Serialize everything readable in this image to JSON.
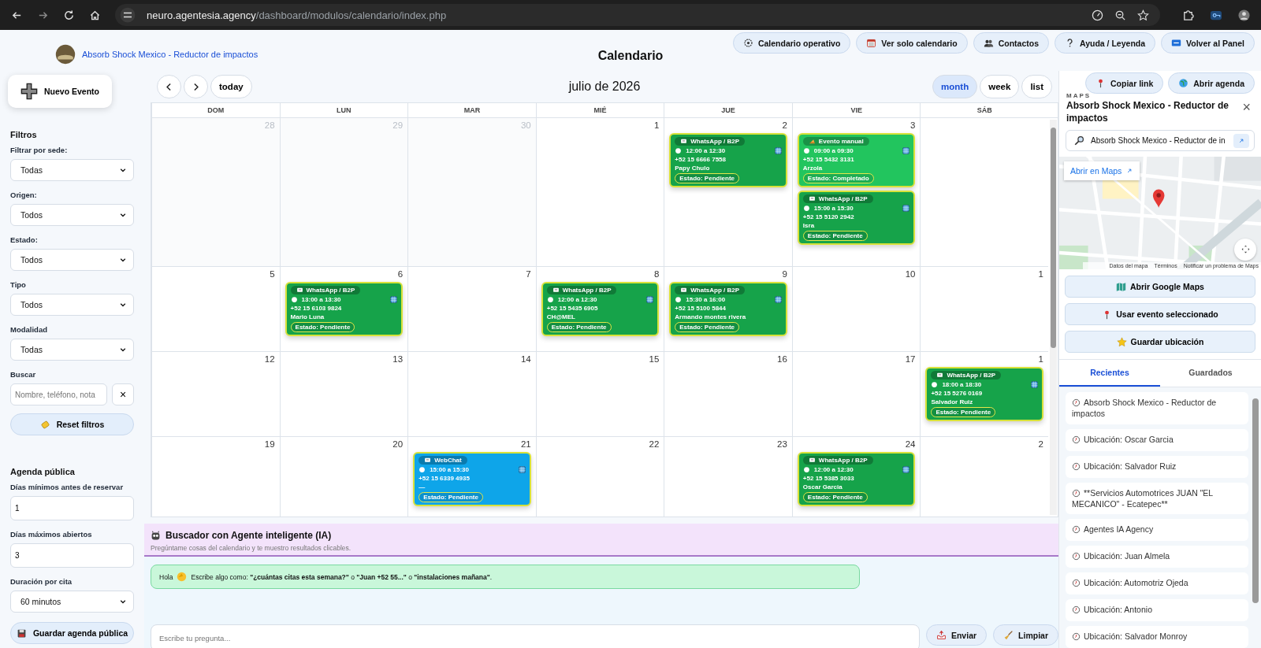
{
  "browser": {
    "host": "neuro.agentesia.agency",
    "path": "/dashboard/modulos/calendario/index.php"
  },
  "header": {
    "brand": "Absorb Shock Mexico - Reductor de impactos",
    "title": "Calendario",
    "actions": [
      "Calendario operativo",
      "Ver solo calendario",
      "Contactos",
      "Ayuda / Leyenda",
      "Volver al Panel"
    ]
  },
  "sidebar": {
    "new_event": "Nuevo Evento",
    "filters_title": "Filtros",
    "filters": [
      {
        "label": "Filtrar por sede:",
        "value": "Todas"
      },
      {
        "label": "Origen:",
        "value": "Todos"
      },
      {
        "label": "Estado:",
        "value": "Todos"
      },
      {
        "label": "Tipo",
        "value": "Todos"
      },
      {
        "label": "Modalidad",
        "value": "Todas"
      }
    ],
    "search": {
      "label": "Buscar",
      "placeholder": "Nombre, teléfono, nota",
      "clear": "×"
    },
    "reset": "Reset filtros",
    "public_title": "Agenda pública",
    "public_fields": [
      {
        "label": "Días mínimos antes de reservar",
        "value": "1",
        "kind": "input"
      },
      {
        "label": "Días máximos abiertos",
        "value": "3",
        "kind": "input"
      },
      {
        "label": "Duración por cita",
        "value": "60 minutos",
        "kind": "select"
      }
    ],
    "save": "Guardar agenda pública"
  },
  "calendar": {
    "today": "today",
    "title": "julio de 2026",
    "views": [
      {
        "label": "month",
        "selected": true
      },
      {
        "label": "week",
        "selected": false
      },
      {
        "label": "list",
        "selected": false
      }
    ],
    "weekdays": [
      "DOM",
      "LUN",
      "MAR",
      "MIÉ",
      "JUE",
      "VIE",
      "SÁB"
    ],
    "weeks": [
      {
        "days": [
          {
            "number": "28",
            "other_month": true
          },
          {
            "number": "29",
            "other_month": true
          },
          {
            "number": "30",
            "other_month": true
          },
          {
            "number": "1",
            "other_month": false
          },
          {
            "number": "2",
            "other_month": false,
            "events": [
              {
                "channel": "WhatsApp / B2P",
                "kind": "chat",
                "time": "12:00 a 12:30",
                "phone": "+52 15 6666 7558",
                "name": "Papy Chulo",
                "status": "Estado: Pendiente",
                "color": "#16a34a"
              }
            ]
          },
          {
            "number": "3",
            "other_month": false,
            "events": [
              {
                "channel": "Evento manual",
                "kind": "manual",
                "time": "09:00 a 09:30",
                "phone": "+52 15 5432 3131",
                "name": "Arzola",
                "status": "Estado: Completado",
                "color": "#22c55e"
              },
              {
                "channel": "WhatsApp / B2P",
                "kind": "chat",
                "time": "15:00 a 15:30",
                "phone": "+52 15 5120 2942",
                "name": "Isra",
                "status": "Estado: Pendiente",
                "color": "#16a34a"
              }
            ]
          }
        ]
      },
      {
        "days": [
          {
            "number": "5",
            "other_month": false
          },
          {
            "number": "6",
            "other_month": false,
            "events": [
              {
                "channel": "WhatsApp / B2P",
                "kind": "chat",
                "time": "13:00 a 13:30",
                "phone": "+52 15 6103 9824",
                "name": "Mario Luna",
                "status": "Estado: Pendiente",
                "color": "#16a34a"
              }
            ]
          },
          {
            "number": "7",
            "other_month": false
          },
          {
            "number": "8",
            "other_month": false,
            "events": [
              {
                "channel": "WhatsApp / B2P",
                "kind": "chat",
                "time": "12:00 a 12:30",
                "phone": "+52 15 5435 6905",
                "name": "CH@MEL",
                "status": "Estado: Pendiente",
                "color": "#16a34a"
              }
            ]
          },
          {
            "number": "9",
            "other_month": false,
            "events": [
              {
                "channel": "WhatsApp / B2P",
                "kind": "chat",
                "time": "15:30 a 16:00",
                "phone": "+52 15 5100 5844",
                "name": "Armando montes rivera",
                "status": "Estado: Pendiente",
                "color": "#16a34a"
              }
            ]
          },
          {
            "number": "10",
            "other_month": false
          },
          {
            "number": "1",
            "other_month": false
          }
        ]
      },
      {
        "days": [
          {
            "number": "12",
            "other_month": false
          },
          {
            "number": "13",
            "other_month": false
          },
          {
            "number": "14",
            "other_month": false
          },
          {
            "number": "15",
            "other_month": false
          },
          {
            "number": "16",
            "other_month": false
          },
          {
            "number": "17",
            "other_month": false
          },
          {
            "number": "1",
            "other_month": false,
            "events": [
              {
                "channel": "WhatsApp / B2P",
                "kind": "chat",
                "time": "18:00 a 18:30",
                "phone": "+52 15 5276 0169",
                "name": "Salvador Ruiz",
                "status": "Estado: Pendiente",
                "color": "#16a34a"
              }
            ]
          }
        ]
      },
      {
        "days": [
          {
            "number": "19",
            "other_month": false
          },
          {
            "number": "20",
            "other_month": false
          },
          {
            "number": "21",
            "other_month": false,
            "events": [
              {
                "channel": "WebChat",
                "kind": "chat",
                "time": "15:00 a 15:30",
                "phone": "+52 15 6339 4935",
                "name": "—",
                "status": "Estado: Pendiente",
                "color": "#0ea5e9"
              }
            ]
          },
          {
            "number": "22",
            "other_month": false
          },
          {
            "number": "23",
            "other_month": false
          },
          {
            "number": "24",
            "other_month": false,
            "events": [
              {
                "channel": "WhatsApp / B2P",
                "kind": "chat",
                "time": "12:00 a 12:30",
                "phone": "+52 15 5385 3033",
                "name": "Oscar Garcia",
                "status": "Estado: Pendiente",
                "color": "#16a34a"
              }
            ]
          },
          {
            "number": "2",
            "other_month": false
          }
        ]
      }
    ]
  },
  "ai": {
    "title": "Buscador con Agente inteligente (IA)",
    "subtitle": "Pregúntame cosas del calendario y te muestro resultados clicables.",
    "greeting": "Hola",
    "message": "Escribe algo como: **\"¿cuántas citas esta semana?\"** o **\"Juan +52 55...\"** o **\"instalaciones mañana\"**.",
    "placeholder": "Escribe tu pregunta...",
    "send": "Enviar",
    "clear": "Limpiar"
  },
  "maps": {
    "top_actions": [
      "Copiar link",
      "Abrir agenda"
    ],
    "label": "MAPS",
    "title": "Absorb Shock Mexico - Reductor de impactos",
    "close": "×",
    "search_value": "Absorb Shock Mexico - Reductor de in",
    "open_in_maps": "Abrir en Maps",
    "attribution": [
      "Datos del mapa",
      "Términos",
      "Notificar un problema de Maps"
    ],
    "actions": [
      "Abrir Google Maps",
      "Usar evento seleccionado",
      "Guardar ubicación"
    ],
    "tabs": [
      {
        "label": "Recientes",
        "selected": true
      },
      {
        "label": "Guardados",
        "selected": false
      }
    ],
    "recents": [
      "Absorb Shock Mexico - Reductor de impactos",
      "Ubicación: Oscar Garcia",
      "Ubicación: Salvador Ruiz",
      "**Servicios Automotrices JUAN \"EL MECANICO\" - Ecatepec**",
      "Agentes IA Agency",
      "Ubicación: Juan Almela",
      "Ubicación: Automotriz Ojeda",
      "Ubicación: Antonio",
      "Ubicación: Salvador Monroy"
    ]
  }
}
